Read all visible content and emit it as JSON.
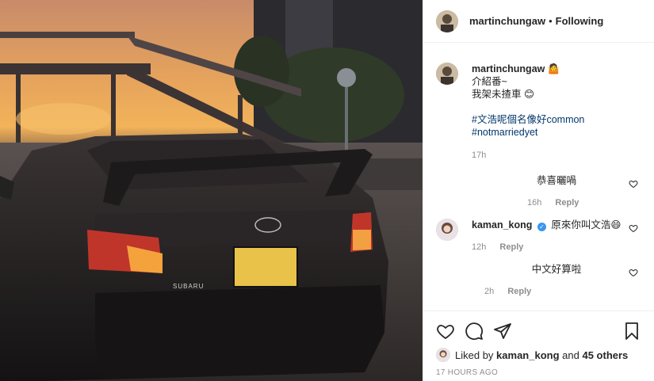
{
  "header": {
    "username": "martinchungaw",
    "separator": "•",
    "follow_state": "Following"
  },
  "post": {
    "username": "martinchungaw",
    "emoji": "🤷",
    "line1": "介紹番~",
    "line2": "我架未揸車",
    "line2_emoji": "😊",
    "hashtag1": "#文浩呢個名像好common",
    "hashtag2": "#notmarriedyet",
    "time": "17h"
  },
  "comments": [
    {
      "text": "恭喜曬喎",
      "time": "16h",
      "reply_label": "Reply"
    },
    {
      "username": "kaman_kong",
      "text": "原來你叫文浩",
      "emoji": "😄",
      "time": "12h",
      "reply_label": "Reply"
    },
    {
      "text": "中文好算啦",
      "time": "2h",
      "reply_label": "Reply"
    }
  ],
  "likes": {
    "prefix": "Liked by",
    "user": "kaman_kong",
    "and": "and",
    "others": "45 others"
  },
  "posted_when": "17 HOURS AGO",
  "icons": [
    "heart-icon",
    "comment-icon",
    "share-icon",
    "save-icon",
    "verified-badge-icon"
  ],
  "colors": {
    "link": "#00376b",
    "meta": "#8e8e8e",
    "verified": "#3897f0",
    "text": "#262626"
  }
}
